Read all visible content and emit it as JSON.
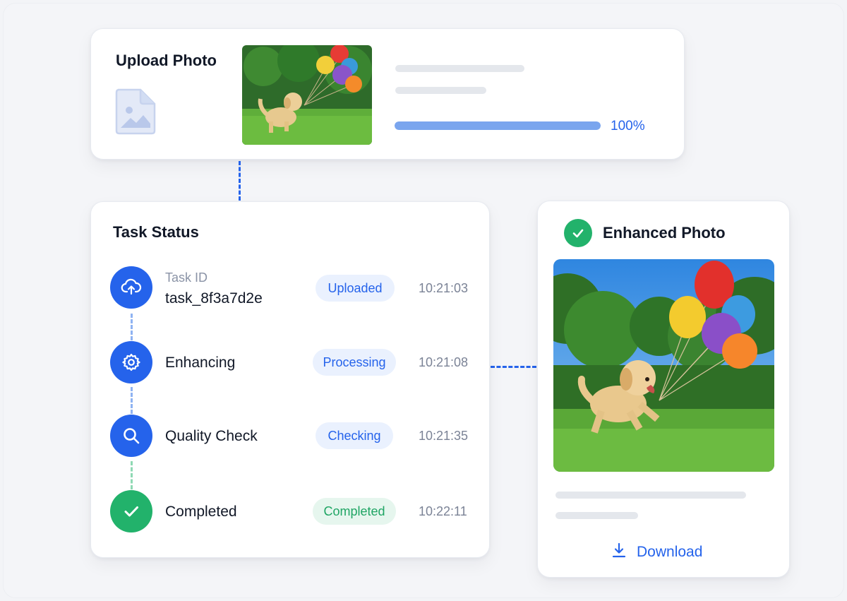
{
  "upload": {
    "title": "Upload Photo",
    "progress_percent": 100,
    "progress_label": "100%",
    "icon": "image-icon"
  },
  "status": {
    "title": "Task Status",
    "steps": [
      {
        "label": "task_8f3a7d2e",
        "sublabel": "Task ID",
        "badge": "Uploaded",
        "time": "10:21:03",
        "icon": "cloud-upload-icon",
        "color": "#2563eb"
      },
      {
        "label": "Enhancing",
        "badge": "Processing",
        "time": "10:21:08",
        "icon": "gear-icon",
        "color": "#2563eb"
      },
      {
        "label": "Quality Check",
        "badge": "Checking",
        "time": "10:21:35",
        "icon": "search-icon",
        "color": "#2563eb"
      },
      {
        "label": "Completed",
        "badge": "Completed",
        "time": "10:22:11",
        "icon": "check-icon",
        "color": "#22b26b"
      }
    ]
  },
  "enhanced": {
    "title": "Enhanced Photo",
    "download_label": "Download",
    "icon": "download-icon"
  },
  "colors": {
    "accent": "#2563eb",
    "success": "#22b26b",
    "progress": "#7aa5ee"
  }
}
